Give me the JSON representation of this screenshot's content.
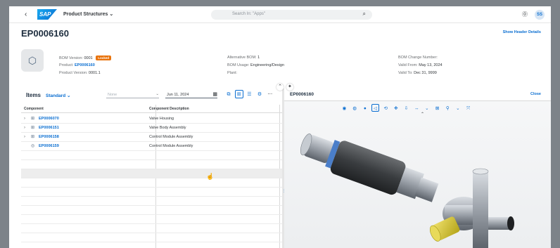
{
  "shell": {
    "brand": "SAP",
    "app_title": "Product Structures",
    "search_placeholder": "Search In: \"Apps\"",
    "user_initials": "SS"
  },
  "header": {
    "title": "EP0006160",
    "show_header_details": "Show Header Details",
    "col1": {
      "bom_version_label": "BOM Version:",
      "bom_version_value": "0001",
      "locked_badge": "Locked",
      "product_label": "Product:",
      "product_value": "EP0006160",
      "product_version_label": "Product Version:",
      "product_version_value": "0001.1"
    },
    "col2": {
      "alt_bom_label": "Alternative BOM:",
      "alt_bom_value": "1",
      "bom_usage_label": "BOM Usage:",
      "bom_usage_value": "Engineering/Design",
      "plant_label": "Plant:"
    },
    "col3": {
      "change_number_label": "BOM Change Number:",
      "valid_from_label": "Valid From:",
      "valid_from_value": "May 13, 2024",
      "valid_to_label": "Valid To:",
      "valid_to_value": "Dec 31, 9999"
    }
  },
  "items": {
    "title": "Items",
    "variant": "Standard",
    "filter_placeholder": "None",
    "date_value": "Jun 11, 2024",
    "columns": [
      "Component",
      "Component Description"
    ],
    "rows": [
      {
        "component": "EP0006070",
        "description": "Valve Housing",
        "expandable": true
      },
      {
        "component": "EP0006151",
        "description": "Valve Body Assembly",
        "expandable": true
      },
      {
        "component": "EP0006158",
        "description": "Control Module Assembly",
        "expandable": true
      },
      {
        "component": "EP0006159",
        "description": "Control Module Assembly",
        "expandable": false
      }
    ]
  },
  "viewer": {
    "title": "EP0006160",
    "close_label": "Close"
  },
  "colors": {
    "accent": "#0a6ed1",
    "badge": "#e9730c",
    "model_yellow": "#d4c22a"
  }
}
